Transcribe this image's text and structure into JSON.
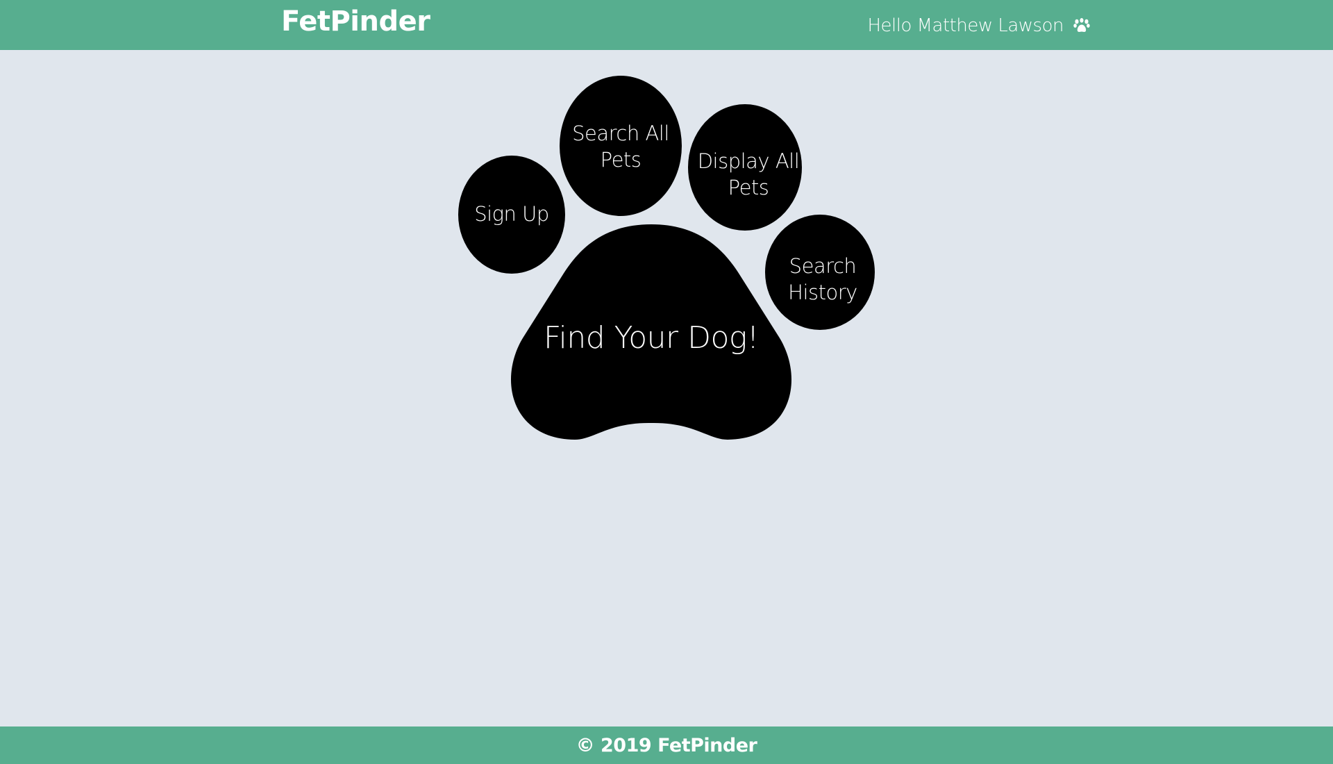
{
  "header": {
    "brand": "FetPinder",
    "greeting": "Hello Matthew Lawson",
    "greeting_icon": "paw-icon"
  },
  "paw_menu": {
    "items": [
      {
        "label": "Sign Up"
      },
      {
        "label": "Search All Pets"
      },
      {
        "label": "Display All Pets"
      },
      {
        "label": "Search History"
      }
    ],
    "main_pad_label": "Find Your Dog!"
  },
  "footer": {
    "text": "© 2019 FetPinder"
  },
  "colors": {
    "header_bg": "#57ae8f",
    "page_bg": "#e0e6ed",
    "paw": "#000000",
    "text_light": "#ffffff"
  }
}
